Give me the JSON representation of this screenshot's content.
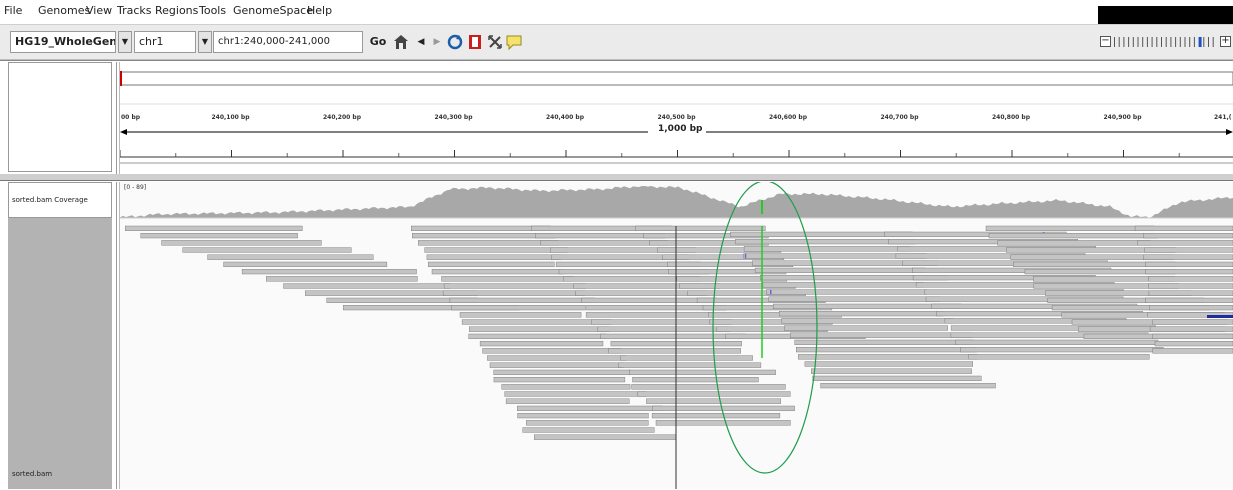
{
  "menu": {
    "items": [
      "File",
      "Genomes",
      "View",
      "Tracks",
      "Regions",
      "Tools",
      "GenomeSpace",
      "Help"
    ]
  },
  "toolbar": {
    "genome": "HG19_WholeGenom...",
    "chromosome": "chr1",
    "locus": "chr1:240,000-241,000",
    "go_label": "Go",
    "icons": [
      "home-icon",
      "back-icon",
      "forward-icon",
      "refresh-icon",
      "roi-icon",
      "resize-icon",
      "popup-info-icon"
    ],
    "zoom_minus": "−",
    "zoom_plus": "+",
    "zoom_level": 0.85
  },
  "ruler": {
    "span_label": "1,000 bp",
    "ticks": [
      "00 bp",
      "240,100 bp",
      "240,200 bp",
      "240,300 bp",
      "240,400 bp",
      "240,500 bp",
      "240,600 bp",
      "240,700 bp",
      "240,800 bp",
      "240,900 bp",
      "241,("
    ]
  },
  "tracks": {
    "coverage_label": "sorted.bam Coverage",
    "coverage_range": "[0 - 89]",
    "alignment_label": "sorted.bam"
  },
  "colors": {
    "coverage": "#a8a8a8",
    "read": "#c4c4c4",
    "read_edge": "#6e6e6e",
    "mismatch": "#22cc22",
    "insertion": "#6666dd",
    "annotation_ellipse": "#1f9d4a",
    "region_marker": "#cc0000",
    "read_highlight": "#1f2c9c"
  }
}
